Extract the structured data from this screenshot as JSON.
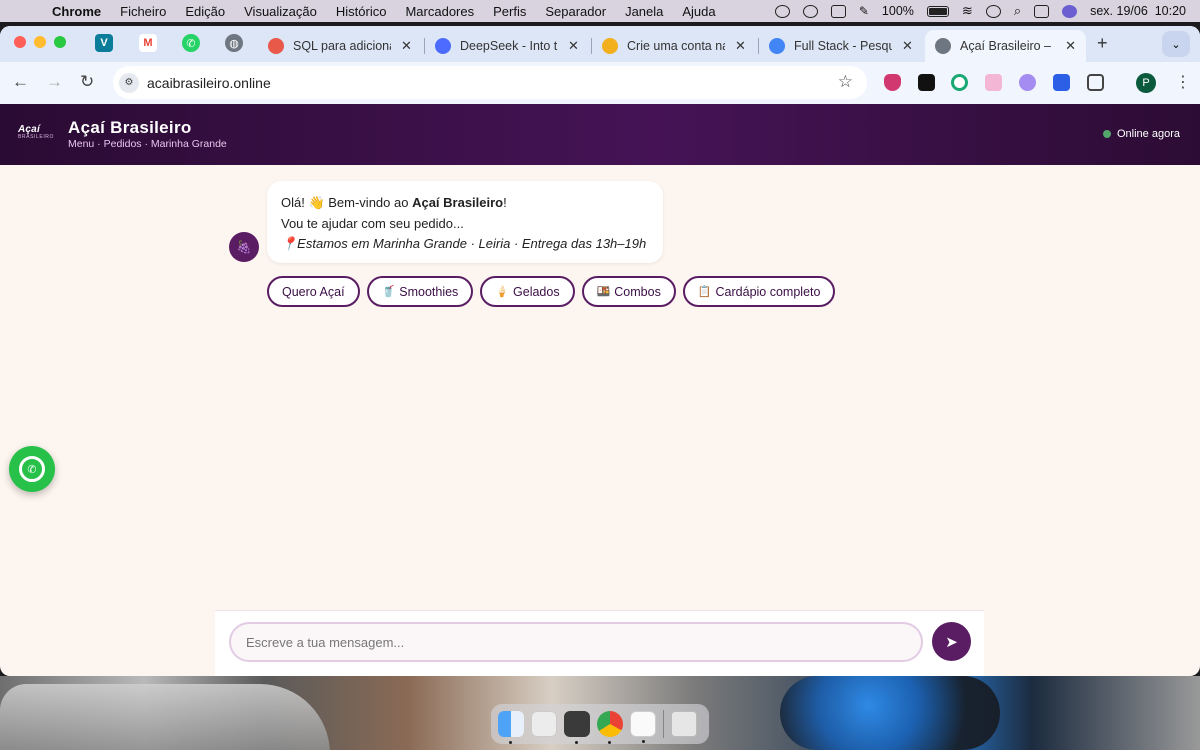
{
  "menubar": {
    "app_name": "Chrome",
    "items": [
      "Ficheiro",
      "Edição",
      "Visualização",
      "Histórico",
      "Marcadores",
      "Perfis",
      "Separador",
      "Janela",
      "Ajuda"
    ],
    "battery": "100%",
    "datetime": "sex. 19/06  10:20"
  },
  "tabs": [
    {
      "title": "SQL para adicionar",
      "favicon_color": "#e8594a"
    },
    {
      "title": "DeepSeek - Into th",
      "favicon_color": "#4d6bfe"
    },
    {
      "title": "Crie uma conta na",
      "favicon_color": "#f2b01e"
    },
    {
      "title": "Full Stack - Pesqui",
      "favicon_color": "#4285f4"
    },
    {
      "title": "Açaí Brasileiro – Fa",
      "favicon_color": "#6e7781"
    }
  ],
  "pinned_tabs": [
    {
      "name": "V",
      "color": "#0a7d9a"
    },
    {
      "name": "M",
      "color": "#ea4335"
    },
    {
      "name": "W",
      "color": "#25d366"
    },
    {
      "name": "G",
      "color": "#6e7781"
    }
  ],
  "address_bar": {
    "url": "acaibrasileiro.online"
  },
  "profile_initial": "P",
  "site": {
    "logo_line1": "Açaí",
    "logo_line2": "BRASILEIRO",
    "brand": "Açaí Brasileiro",
    "subtitle": "Menu · Pedidos · Marinha Grande",
    "status": "Online agora",
    "accent": "#5a1d63"
  },
  "chat": {
    "greeting_prefix": "Olá! 👋 Bem-vindo ao ",
    "greeting_brand": "Açaí Brasileiro",
    "greeting_suffix": "!",
    "line2": "Vou te ajudar com seu pedido...",
    "line3": "📍Estamos em Marinha Grande · Leiria · Entrega das 13h–19h",
    "quick_replies": [
      {
        "icon": "",
        "label": "Quero Açaí"
      },
      {
        "icon": "🥤",
        "label": "Smoothies"
      },
      {
        "icon": "🍦",
        "label": "Gelados"
      },
      {
        "icon": "🍱",
        "label": "Combos"
      },
      {
        "icon": "📋",
        "label": "Cardápio completo"
      }
    ]
  },
  "composer": {
    "placeholder": "Escreve a tua mensagem..."
  }
}
